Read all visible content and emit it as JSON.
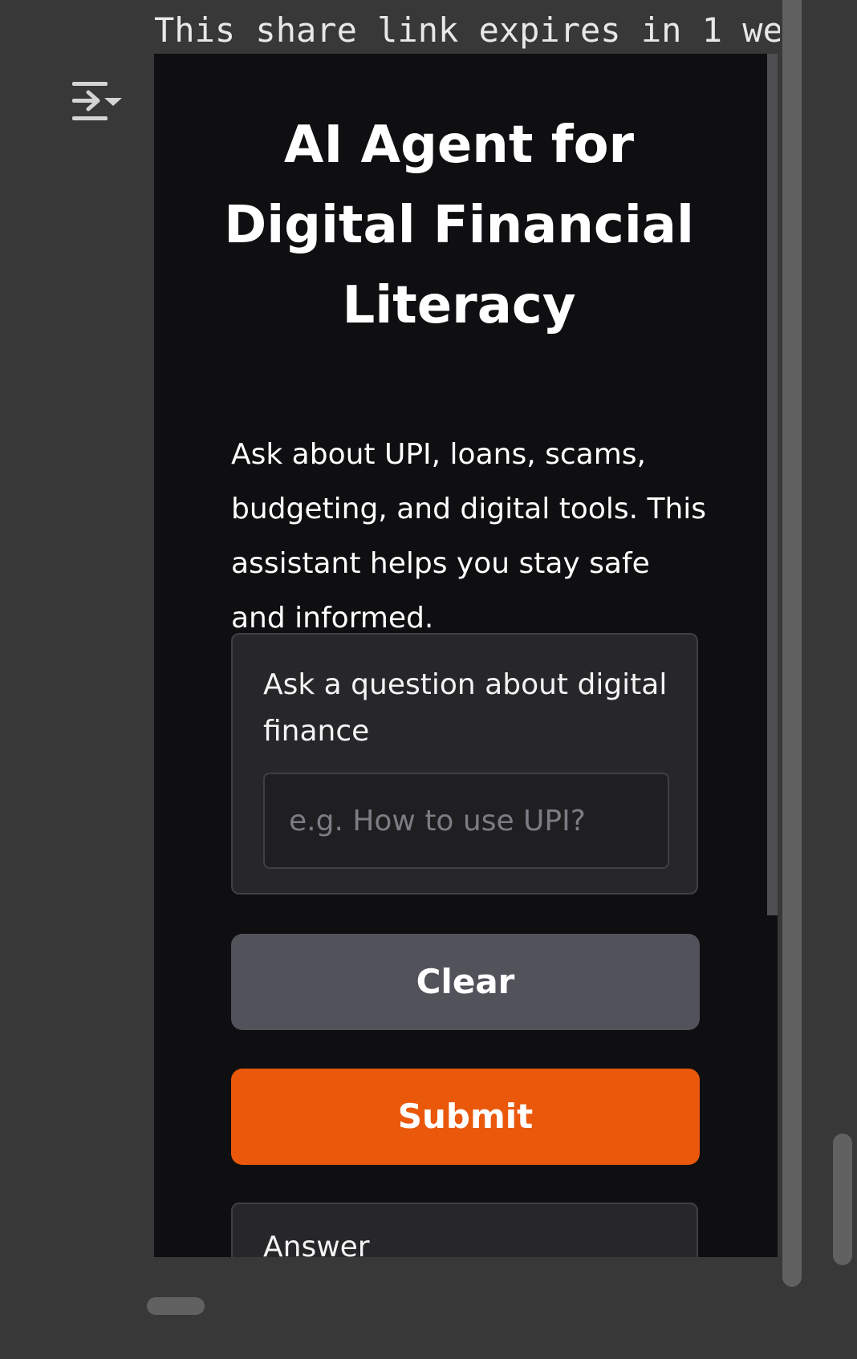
{
  "banner": {
    "text": "This share link expires in 1 we"
  },
  "icons": {
    "collapse": "collapse-sidebar-icon"
  },
  "app": {
    "title": "AI Agent for Digital Financial Literacy",
    "description": "Ask about UPI, loans, scams, budgeting, and digital tools. This assistant helps you stay safe and informed."
  },
  "question": {
    "label": "Ask a question about digital finance",
    "placeholder": "e.g. How to use UPI?",
    "value": ""
  },
  "buttons": {
    "clear": "Clear",
    "submit": "Submit"
  },
  "answer": {
    "label": "Answer"
  },
  "colors": {
    "page_bg": "#383838",
    "frame_bg": "#0f0f11",
    "block_bg": "#27272a",
    "clear_button": "#52525b",
    "submit_button": "#ea580c"
  }
}
